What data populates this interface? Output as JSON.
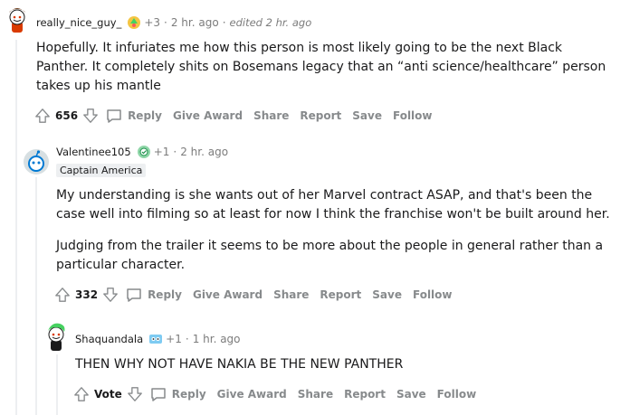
{
  "comments": [
    {
      "author": "really_nice_guy_",
      "award_count": "+3",
      "time": "2 hr. ago",
      "edited": "edited 2 hr. ago",
      "body": [
        "Hopefully. It infuriates me how this person is most likely going to be the next Black Panther. It completely shits on Bosemans legacy that an “anti science/healthcare” person takes up his mantle"
      ],
      "score": "656"
    },
    {
      "author": "Valentinee105",
      "award_count": "+1",
      "time": "2 hr. ago",
      "flair": "Captain America",
      "body": [
        "My understanding is she wants out of her Marvel contract ASAP, and that's been the case well into filming so at least for now I think the franchise won't be built around her.",
        "Judging from the trailer it seems to be more about the people in general rather than a particular character."
      ],
      "score": "332"
    },
    {
      "author": "Shaquandala",
      "award_count": "+1",
      "time": "1 hr. ago",
      "body": [
        "THEN WHY NOT HAVE NAKIA BE THE NEW PANTHER"
      ],
      "score": "Vote"
    }
  ],
  "actions": {
    "reply": "Reply",
    "give_award": "Give Award",
    "share": "Share",
    "report": "Report",
    "save": "Save",
    "follow": "Follow"
  },
  "separator": "·",
  "icons": {
    "upvote": "upvote-arrow-icon",
    "downvote": "downvote-arrow-icon",
    "reply": "speech-bubble-icon",
    "award": "award-icon"
  },
  "colors": {
    "action_text": "#878a8c",
    "meta_text": "#7c7c7c",
    "flair_bg": "#edeff1",
    "thread_line": "#edeff1"
  }
}
